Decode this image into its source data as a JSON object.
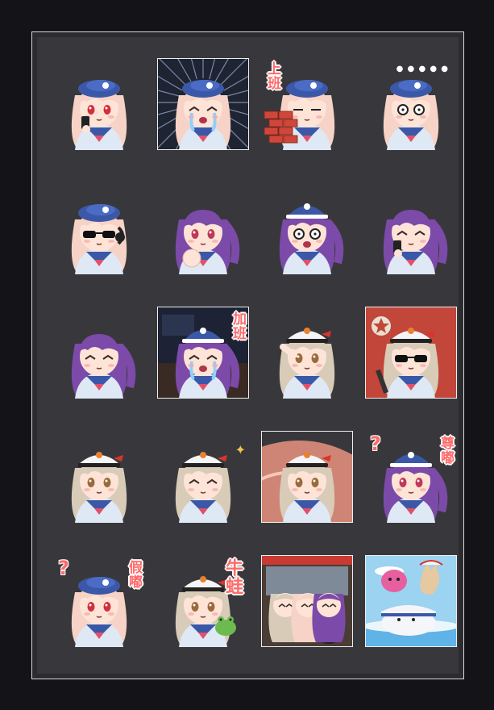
{
  "colors": {
    "page_bg": "#131318",
    "panel_bg": "#38383c",
    "frame_border": "#d9d9df",
    "caption_red": "#ff6b6b"
  },
  "stickers": [
    {
      "id": 1,
      "character": "pink-hair-girl",
      "hat": "navy-beret",
      "bg": "none",
      "extras": "phone, sweat drop"
    },
    {
      "id": 2,
      "character": "pink-hair-girl",
      "hat": "navy-beret",
      "bg": "speed-lines",
      "extras": "crying"
    },
    {
      "id": 3,
      "character": "pink-hair-girl",
      "hat": "navy-beret",
      "bg": "none",
      "caption": "上班",
      "extras": "brick wall"
    },
    {
      "id": 4,
      "character": "pink-hair-girl",
      "hat": "navy-beret",
      "bg": "none",
      "extras": "dots"
    },
    {
      "id": 5,
      "character": "pink-hair-girl",
      "hat": "navy-beret",
      "bg": "none",
      "extras": "sunglasses, headset"
    },
    {
      "id": 6,
      "character": "purple-hair-girl",
      "hat": "none",
      "bg": "none",
      "extras": "punch"
    },
    {
      "id": 7,
      "character": "purple-hair-girl",
      "hat": "navy-cap",
      "bg": "none",
      "extras": "shocked"
    },
    {
      "id": 8,
      "character": "purple-hair-girl",
      "hat": "none",
      "bg": "none",
      "extras": "phone, eyes closed"
    },
    {
      "id": 9,
      "character": "purple-hair-girl",
      "hat": "none",
      "bg": "none",
      "extras": "smug blush"
    },
    {
      "id": 10,
      "character": "purple-hair-girl",
      "hat": "navy-cap",
      "bg": "dark-office",
      "caption": "加班",
      "extras": "crying"
    },
    {
      "id": 11,
      "character": "beige-hair-girl",
      "hat": "white-cap",
      "bg": "none",
      "extras": "salute"
    },
    {
      "id": 12,
      "character": "beige-hair-girl",
      "hat": "white-cap",
      "bg": "red-star",
      "extras": "sunglasses, gun"
    },
    {
      "id": 13,
      "character": "beige-hair-girl",
      "hat": "white-cap",
      "bg": "none",
      "extras": "neutral"
    },
    {
      "id": 14,
      "character": "beige-hair-girl",
      "hat": "white-cap",
      "bg": "none",
      "extras": "sparkles"
    },
    {
      "id": 15,
      "character": "beige-hair-girl",
      "hat": "white-cap",
      "bg": "orange-swoosh",
      "extras": "running away"
    },
    {
      "id": 16,
      "character": "purple-hair-girl",
      "hat": "navy-cap",
      "bg": "none",
      "caption": "尊嘟",
      "extras": "question mark"
    },
    {
      "id": 17,
      "character": "pink-hair-girl",
      "hat": "navy-beret",
      "bg": "none",
      "caption": "假嘟",
      "extras": "question mark"
    },
    {
      "id": 18,
      "character": "beige-hair-girl",
      "hat": "white-cap",
      "bg": "none",
      "caption": "牛蛙",
      "extras": "frog"
    },
    {
      "id": 19,
      "character": "group",
      "hat": "mixed",
      "bg": "car-interior",
      "extras": "three girls"
    },
    {
      "id": 20,
      "character": "seal-and-cat",
      "hat": "white-cap",
      "bg": "sky-sea",
      "extras": "pink blob"
    }
  ]
}
